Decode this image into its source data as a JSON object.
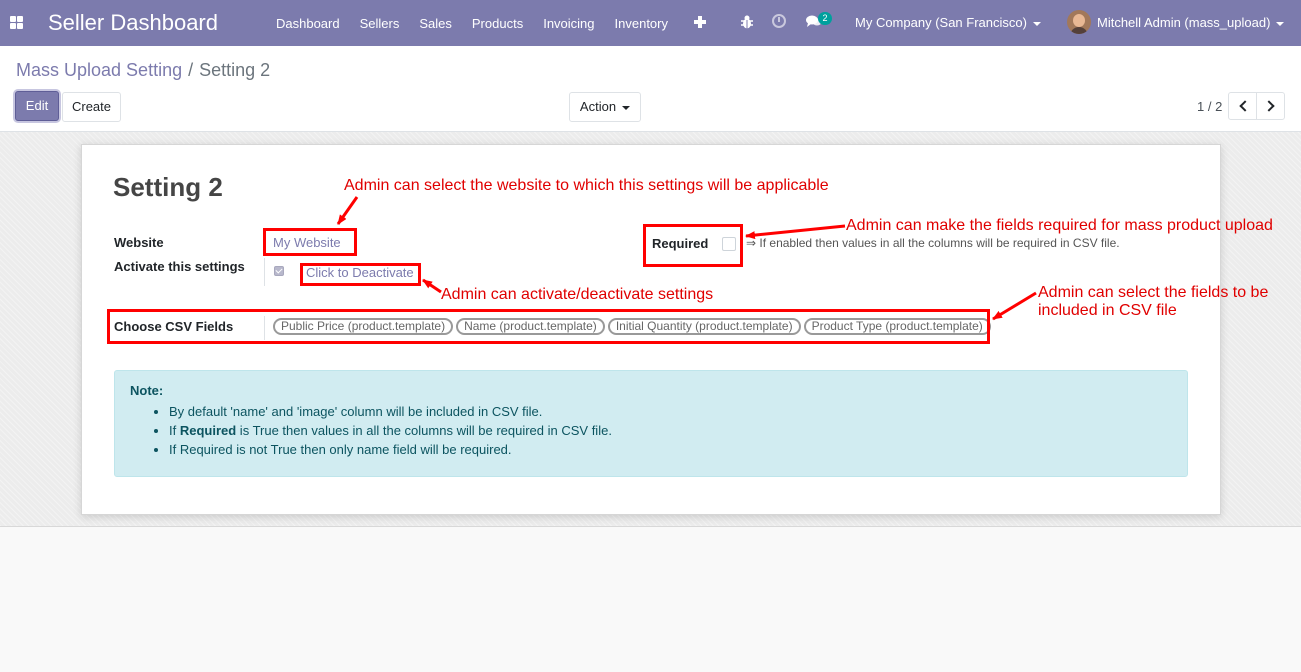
{
  "navbar": {
    "brand": "Seller Dashboard",
    "menu": [
      "Dashboard",
      "Sellers",
      "Sales",
      "Products",
      "Invoicing",
      "Inventory"
    ],
    "chat_count": "2",
    "company": "My Company (San Francisco)",
    "user": "Mitchell Admin (mass_upload)",
    "bg_color": "#7c7bad"
  },
  "control_panel": {
    "breadcrumb_parent": "Mass Upload Setting",
    "breadcrumb_separator": "/",
    "breadcrumb_current": "Setting 2",
    "edit_label": "Edit",
    "create_label": "Create",
    "action_label": "Action",
    "pager": "1 / 2"
  },
  "form": {
    "title": "Setting 2",
    "website_label": "Website",
    "website_value": "My Website",
    "activate_label": "Activate this settings",
    "activate_checked": true,
    "deactivate_link": "Click to Deactivate",
    "required_label": "Required",
    "required_checked": false,
    "required_help": "⇒ If enabled then values in all the columns will be required in CSV file.",
    "csv_label": "Choose CSV Fields",
    "csv_fields": [
      "Public Price (product.template)",
      "Name (product.template)",
      "Initial Quantity (product.template)",
      "Product Type (product.template)"
    ]
  },
  "note": {
    "title": "Note:",
    "item1": "By default 'name' and 'image' column will be included in CSV file.",
    "item2_prefix": "If ",
    "item2_bold": "Required",
    "item2_suffix": " is True then values in all the columns will be required in CSV file.",
    "item3": "If Required is not True then only name field will be required."
  },
  "annotations": {
    "website": "Admin can select the website to which this settings will be applicable",
    "required": "Admin can make the fields required for mass product upload",
    "activate": "Admin can activate/deactivate settings",
    "csv_line1": "Admin can select the fields to be",
    "csv_line2": "included in CSV file",
    "color": "#ff0000"
  }
}
